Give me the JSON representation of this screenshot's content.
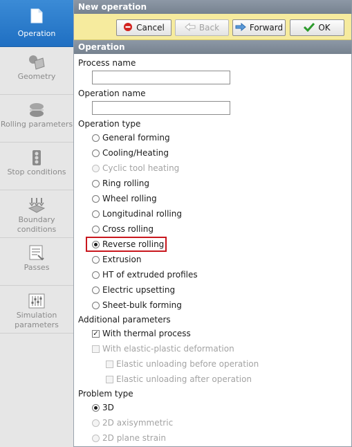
{
  "sidebar": {
    "items": [
      {
        "label": "Operation",
        "icon": "document-icon"
      },
      {
        "label": "Geometry",
        "icon": "geometry-icon"
      },
      {
        "label": "Rolling parameters",
        "icon": "rolling-icon"
      },
      {
        "label": "Stop conditions",
        "icon": "traffic-light-icon"
      },
      {
        "label": "Boundary conditions",
        "icon": "boundary-icon"
      },
      {
        "label": "Passes",
        "icon": "passes-icon"
      },
      {
        "label": "Simulation parameters",
        "icon": "sliders-icon"
      }
    ]
  },
  "header": {
    "title": "New operation"
  },
  "toolbar": {
    "cancel_label": "Cancel",
    "back_label": "Back",
    "forward_label": "Forward",
    "ok_label": "OK"
  },
  "section": {
    "title": "Operation"
  },
  "form": {
    "process_name_label": "Process name",
    "process_name_value": "",
    "operation_name_label": "Operation name",
    "operation_name_value": "",
    "operation_type_label": "Operation type",
    "operation_types": [
      {
        "label": "General forming",
        "selected": false,
        "enabled": true
      },
      {
        "label": "Cooling/Heating",
        "selected": false,
        "enabled": true
      },
      {
        "label": "Cyclic tool heating",
        "selected": false,
        "enabled": false
      },
      {
        "label": "Ring rolling",
        "selected": false,
        "enabled": true
      },
      {
        "label": "Wheel rolling",
        "selected": false,
        "enabled": true
      },
      {
        "label": "Longitudinal rolling",
        "selected": false,
        "enabled": true
      },
      {
        "label": "Cross rolling",
        "selected": false,
        "enabled": true
      },
      {
        "label": "Reverse rolling",
        "selected": true,
        "enabled": true
      },
      {
        "label": "Extrusion",
        "selected": false,
        "enabled": true
      },
      {
        "label": "HT of extruded profiles",
        "selected": false,
        "enabled": true
      },
      {
        "label": "Electric upsetting",
        "selected": false,
        "enabled": true
      },
      {
        "label": "Sheet-bulk forming",
        "selected": false,
        "enabled": true
      }
    ],
    "additional_label": "Additional parameters",
    "additional": [
      {
        "label": "With thermal process",
        "checked": true,
        "enabled": true
      },
      {
        "label": "With elastic-plastic deformation",
        "checked": false,
        "enabled": false
      },
      {
        "label": "Elastic unloading before operation",
        "checked": false,
        "enabled": false
      },
      {
        "label": "Elastic unloading after operation",
        "checked": false,
        "enabled": false
      }
    ],
    "problem_type_label": "Problem type",
    "problem_types": [
      {
        "label": "3D",
        "selected": true,
        "enabled": true
      },
      {
        "label": "2D axisymmetric",
        "selected": false,
        "enabled": false
      },
      {
        "label": "2D plane strain",
        "selected": false,
        "enabled": false
      }
    ]
  },
  "colors": {
    "accent": "#2a7fd0",
    "toolbar_bg": "#f6eb9e",
    "header_bg": "#808b99",
    "highlight": "#c8161d"
  }
}
